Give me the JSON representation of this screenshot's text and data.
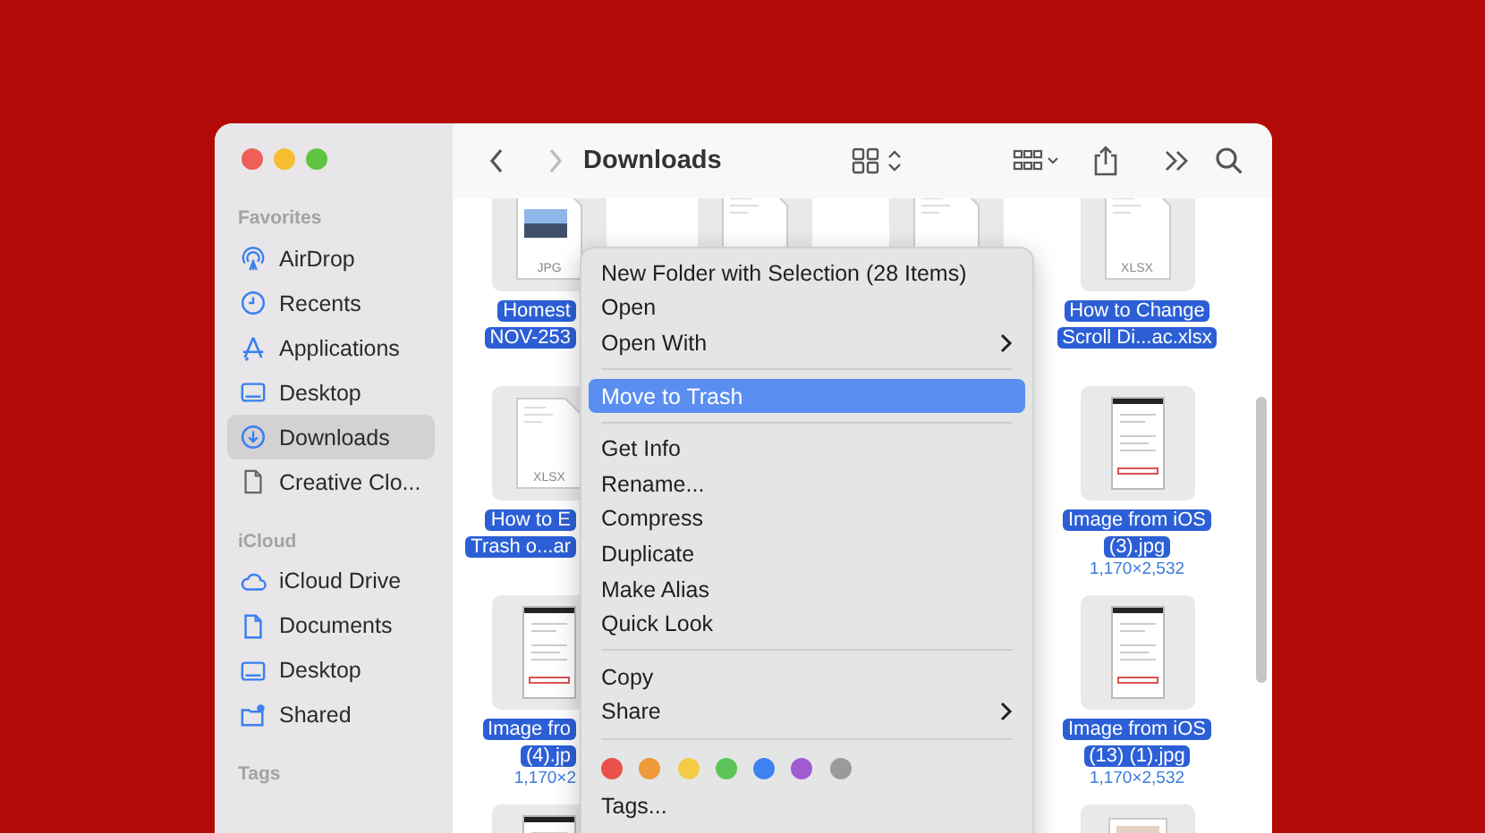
{
  "window": {
    "title": "Downloads"
  },
  "toolbar": {
    "back": {
      "disabled": false
    },
    "forward": {
      "disabled": true
    }
  },
  "sidebar": {
    "sections": [
      {
        "heading": "Favorites",
        "items": [
          {
            "label": "AirDrop",
            "kind": "airdrop",
            "selected": false
          },
          {
            "label": "Recents",
            "kind": "recents",
            "selected": false
          },
          {
            "label": "Applications",
            "kind": "applications",
            "selected": false
          },
          {
            "label": "Desktop",
            "kind": "desktop",
            "selected": false
          },
          {
            "label": "Downloads",
            "kind": "downloads",
            "selected": true
          },
          {
            "label": "Creative Clo...",
            "kind": "document",
            "selected": false
          }
        ]
      },
      {
        "heading": "iCloud",
        "items": [
          {
            "label": "iCloud Drive",
            "kind": "cloud",
            "selected": false
          },
          {
            "label": "Documents",
            "kind": "documents",
            "selected": false
          },
          {
            "label": "Desktop",
            "kind": "desktop",
            "selected": false
          },
          {
            "label": "Shared",
            "kind": "shared",
            "selected": false
          }
        ]
      },
      {
        "heading": "Tags"
      }
    ]
  },
  "files": {
    "columns": [
      {
        "items": [
          {
            "kind": "image",
            "badge": "JPG",
            "name_lines": [
              "Homest",
              "NOV-253"
            ],
            "selected": true
          },
          {
            "kind": "sheet",
            "badge": "XLSX",
            "name_lines": [
              "How to E",
              "Trash o...ar"
            ],
            "selected": true
          },
          {
            "kind": "screenshot",
            "name_lines": [
              "Image fro",
              "(4).jp"
            ],
            "dims": "1,170×2",
            "selected": true
          },
          {
            "kind": "screenshot"
          }
        ]
      },
      {
        "items": [
          {
            "kind": "document"
          }
        ]
      },
      {
        "items": [
          {
            "kind": "document"
          }
        ]
      },
      {
        "items": [
          {
            "kind": "sheet",
            "badge": "XLSX",
            "name_lines": [
              "How to Change",
              "Scroll Di...ac.xlsx"
            ],
            "selected": true
          },
          {
            "kind": "screenshot",
            "name_lines": [
              "Image from iOS",
              "(3).jpg"
            ],
            "dims": "1,170×2,532",
            "selected": true
          },
          {
            "kind": "screenshot",
            "name_lines": [
              "Image from iOS",
              "(13) (1).jpg"
            ],
            "dims": "1,170×2,532",
            "selected": true
          },
          {
            "kind": "photo"
          }
        ]
      }
    ]
  },
  "context_menu": {
    "items": [
      {
        "kind": "item",
        "label": "New Folder with Selection (28 Items)",
        "selected": false,
        "submenu": false
      },
      {
        "kind": "item",
        "label": "Open",
        "selected": false,
        "submenu": false
      },
      {
        "kind": "item",
        "label": "Open With",
        "selected": false,
        "submenu": true
      },
      {
        "kind": "separator"
      },
      {
        "kind": "item",
        "label": "Move to Trash",
        "selected": true,
        "submenu": false
      },
      {
        "kind": "separator"
      },
      {
        "kind": "item",
        "label": "Get Info",
        "selected": false,
        "submenu": false
      },
      {
        "kind": "item",
        "label": "Rename...",
        "selected": false,
        "submenu": false
      },
      {
        "kind": "item",
        "label": "Compress",
        "selected": false,
        "submenu": false
      },
      {
        "kind": "item",
        "label": "Duplicate",
        "selected": false,
        "submenu": false
      },
      {
        "kind": "item",
        "label": "Make Alias",
        "selected": false,
        "submenu": false
      },
      {
        "kind": "item",
        "label": "Quick Look",
        "selected": false,
        "submenu": false
      },
      {
        "kind": "separator"
      },
      {
        "kind": "item",
        "label": "Copy",
        "selected": false,
        "submenu": false
      },
      {
        "kind": "item",
        "label": "Share",
        "selected": false,
        "submenu": true
      },
      {
        "kind": "separator"
      },
      {
        "kind": "colors",
        "colors": [
          {
            "color": "#e9524a"
          },
          {
            "color": "#ee9a3a"
          },
          {
            "color": "#f3cb45"
          },
          {
            "color": "#5dc45a"
          },
          {
            "color": "#3d82f0"
          },
          {
            "color": "#a05bd0"
          },
          {
            "color": "#9a9a9c"
          }
        ]
      },
      {
        "kind": "item",
        "label": "Tags...",
        "selected": false,
        "submenu": false
      }
    ]
  }
}
